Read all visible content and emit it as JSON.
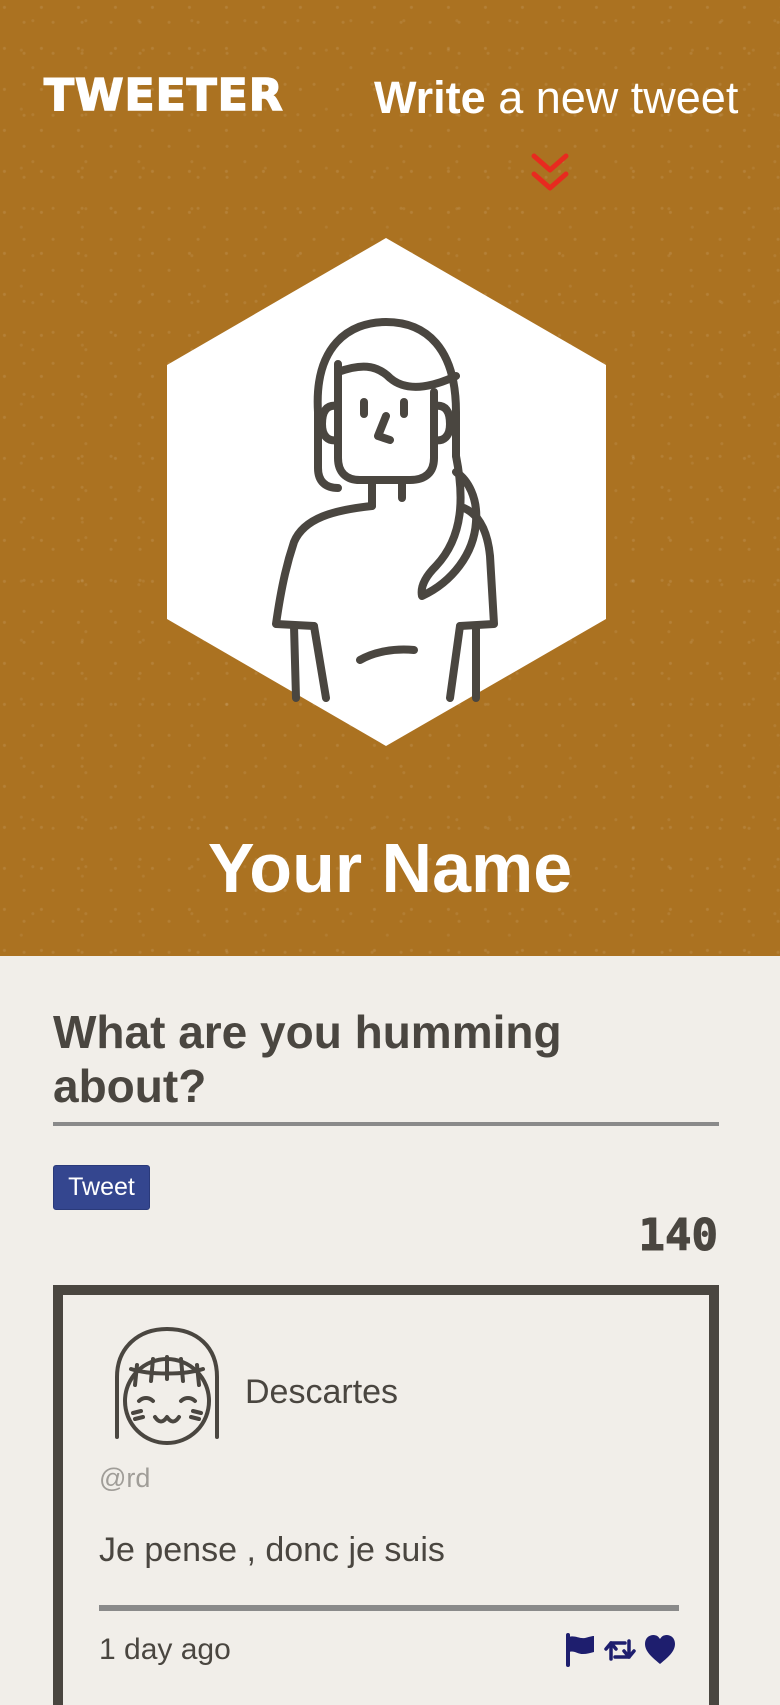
{
  "nav": {
    "logo": "TWEETER",
    "compose_strong": "Write",
    "compose_light": " a new tweet",
    "compose_icon": "double-chevron-down-icon",
    "compose_icon_color": "#e82a1f"
  },
  "profile": {
    "name": "Your Name",
    "avatar_icon": "woman-avatar-icon"
  },
  "compose": {
    "label": "What are you humming about?",
    "textarea_value": "",
    "button_label": "Tweet",
    "char_count": "140"
  },
  "tweets": [
    {
      "author": "Descartes",
      "handle": "@rd",
      "text": "Je pense , donc je suis",
      "time": "1 day ago",
      "avatar_icon": "smiling-face-avatar-icon",
      "actions": [
        "flag-icon",
        "retweet-icon",
        "heart-icon"
      ]
    }
  ],
  "colors": {
    "header_bg": "#ab7221",
    "page_bg": "#f1eee9",
    "text_dark": "#4a4640",
    "button_bg": "#34468f",
    "action_icon_color": "#1e1e6e"
  }
}
